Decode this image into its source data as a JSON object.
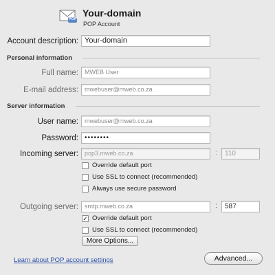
{
  "header": {
    "title": "Your-domain",
    "subtitle": "POP Account",
    "envelope_badge": "POP"
  },
  "account": {
    "description_label": "Account description:",
    "description_value": "Your-domain"
  },
  "personal": {
    "section_label": "Personal information",
    "full_name_label": "Full name:",
    "full_name_value": "MWEB User",
    "email_label": "E-mail address:",
    "email_value": "mwebuser@mweb.co.za"
  },
  "server": {
    "section_label": "Server information",
    "user_name_label": "User name:",
    "user_name_value": "mwebuser@mweb.co.za",
    "password_label": "Password:",
    "password_value": "••••••••",
    "incoming_label": "Incoming server:",
    "incoming_value": "pop3.mweb.co.za",
    "incoming_port": "110",
    "port_separator": ":",
    "incoming_options": [
      {
        "label": "Override default port",
        "checked": false
      },
      {
        "label": "Use SSL to connect (recommended)",
        "checked": false
      },
      {
        "label": "Always use secure password",
        "checked": false
      }
    ],
    "outgoing_label": "Outgoing server:",
    "outgoing_value": "smtp.mweb.co.za",
    "outgoing_port": "587",
    "outgoing_options": [
      {
        "label": "Override default port",
        "checked": true
      },
      {
        "label": "Use SSL to connect (recommended)",
        "checked": false
      }
    ],
    "more_options_label": "More Options..."
  },
  "footer": {
    "learn_link": "Learn about POP account settings",
    "advanced_label": "Advanced..."
  },
  "checkmark": "✓"
}
